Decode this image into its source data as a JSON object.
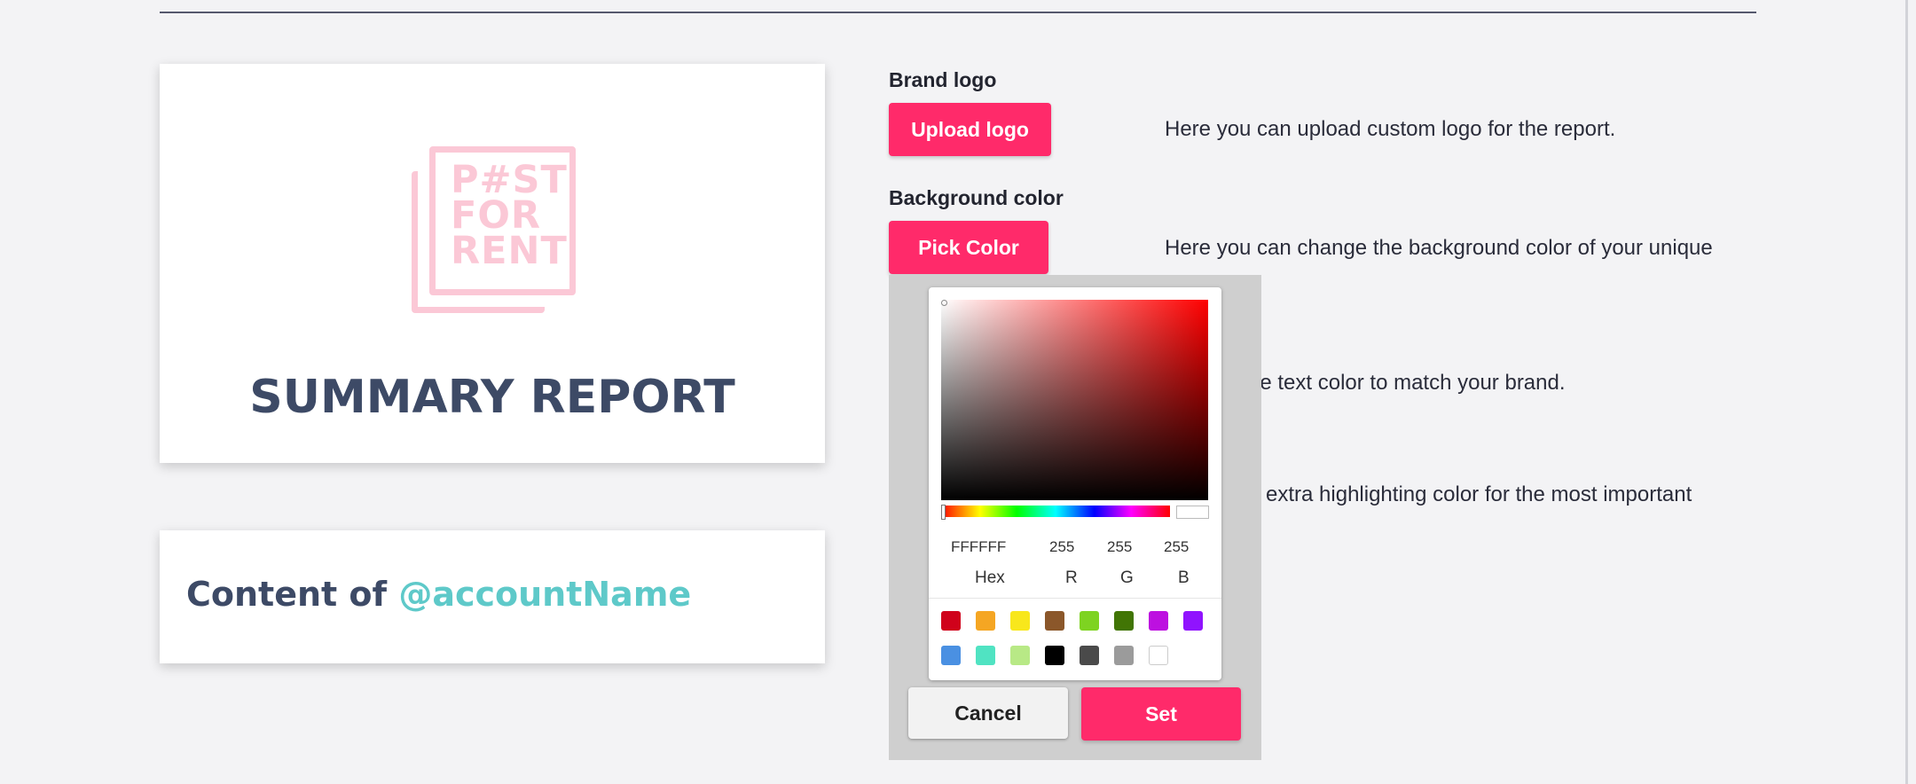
{
  "preview": {
    "logo_lines": [
      "P#ST",
      "FOR",
      "RENT"
    ],
    "report_title": "SUMMARY REPORT"
  },
  "content_card": {
    "prefix": "Content of",
    "account": "@accountName"
  },
  "brand_logo": {
    "label": "Brand logo",
    "button": "Upload logo",
    "description": "Here you can upload custom logo for the report."
  },
  "background_color": {
    "label": "Background color",
    "button": "Pick Color",
    "description": "Here you can change the background color of your unique"
  },
  "partial_descriptions": {
    "text_color": "ne text color to match your brand.",
    "highlight": "n extra highlighting color for the most important"
  },
  "color_picker": {
    "hex_value": "FFFFFF",
    "r_value": "255",
    "g_value": "255",
    "b_value": "255",
    "hex_label": "Hex",
    "r_label": "R",
    "g_label": "G",
    "b_label": "B",
    "swatches": [
      "#d0021b",
      "#f5a623",
      "#f8e71c",
      "#8b572a",
      "#7ed321",
      "#417505",
      "#bd10e0",
      "#9013fe",
      "#4a90e2",
      "#50e3c2",
      "#b8e986",
      "#000000",
      "#4a4a4a",
      "#9b9b9b",
      "#ffffff"
    ],
    "cancel_label": "Cancel",
    "set_label": "Set"
  },
  "colors": {
    "accent_pink": "#ff2a6a",
    "title_navy": "#3d4a66",
    "account_teal": "#5ec9c9"
  }
}
